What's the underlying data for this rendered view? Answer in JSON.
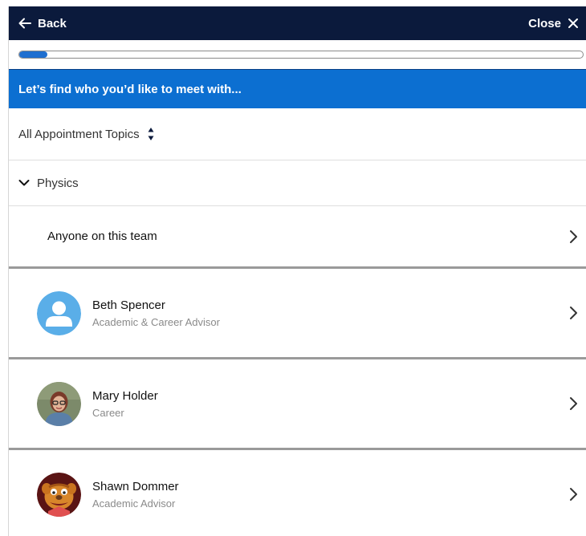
{
  "header": {
    "back_label": "Back",
    "close_label": "Close"
  },
  "progress": {
    "value_percent": 5
  },
  "banner": {
    "text": "Let’s find who you’d like to meet with..."
  },
  "filter": {
    "label": "All Appointment Topics"
  },
  "topic": {
    "label": "Physics"
  },
  "anyone": {
    "label": "Anyone on this team"
  },
  "people": [
    {
      "name": "Beth Spencer",
      "role": "Academic & Career Advisor",
      "avatar": "default-user-avatar"
    },
    {
      "name": "Mary Holder",
      "role": "Career",
      "avatar": "photo-avatar"
    },
    {
      "name": "Shawn Dommer",
      "role": "Academic Advisor",
      "avatar": "photo-avatar"
    }
  ],
  "colors": {
    "header_bg": "#0b1a3c",
    "banner_bg": "#0c6fd1",
    "progress_fill": "#1f6fd0",
    "avatar_default_bg": "#5aaee8"
  }
}
